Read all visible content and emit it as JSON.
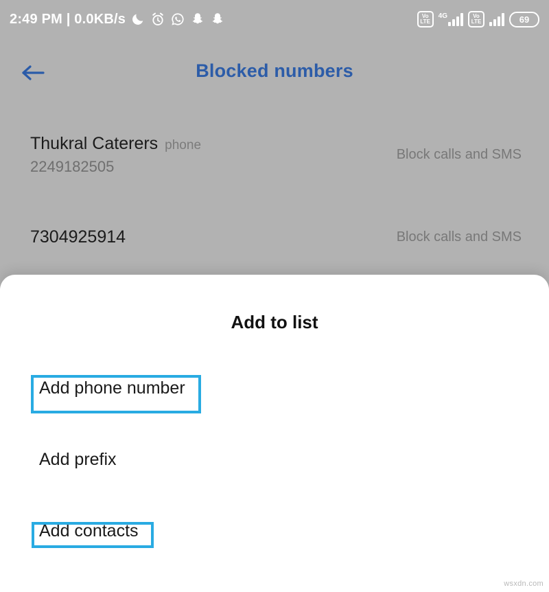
{
  "status_bar": {
    "clock": "2:49 PM | 0.0KB/s",
    "left_icons": [
      "moon-dnd-icon",
      "alarm-icon",
      "whatsapp-icon",
      "snapchat-icon",
      "snapchat-icon"
    ],
    "network_label_1": "4G",
    "volte_top": "Vo",
    "volte_bottom": "LTE",
    "battery_level": "69"
  },
  "app_bar": {
    "back_icon": "back-arrow-icon",
    "title": "Blocked numbers",
    "title_color": "#2c5ca8"
  },
  "blocked_list": [
    {
      "name": "Thukral Caterers",
      "tag": "phone",
      "number": "2249182505",
      "action": "Block calls and SMS"
    },
    {
      "name": "7304925914",
      "tag": "",
      "number": "",
      "action": "Block calls and SMS"
    }
  ],
  "sheet": {
    "title": "Add to list",
    "options": [
      {
        "label": "Add phone number",
        "highlighted": true
      },
      {
        "label": "Add prefix",
        "highlighted": false
      },
      {
        "label": "Add contacts",
        "highlighted": true
      }
    ],
    "highlight_color": "#29abe2"
  },
  "watermark": "wsxdn.com"
}
